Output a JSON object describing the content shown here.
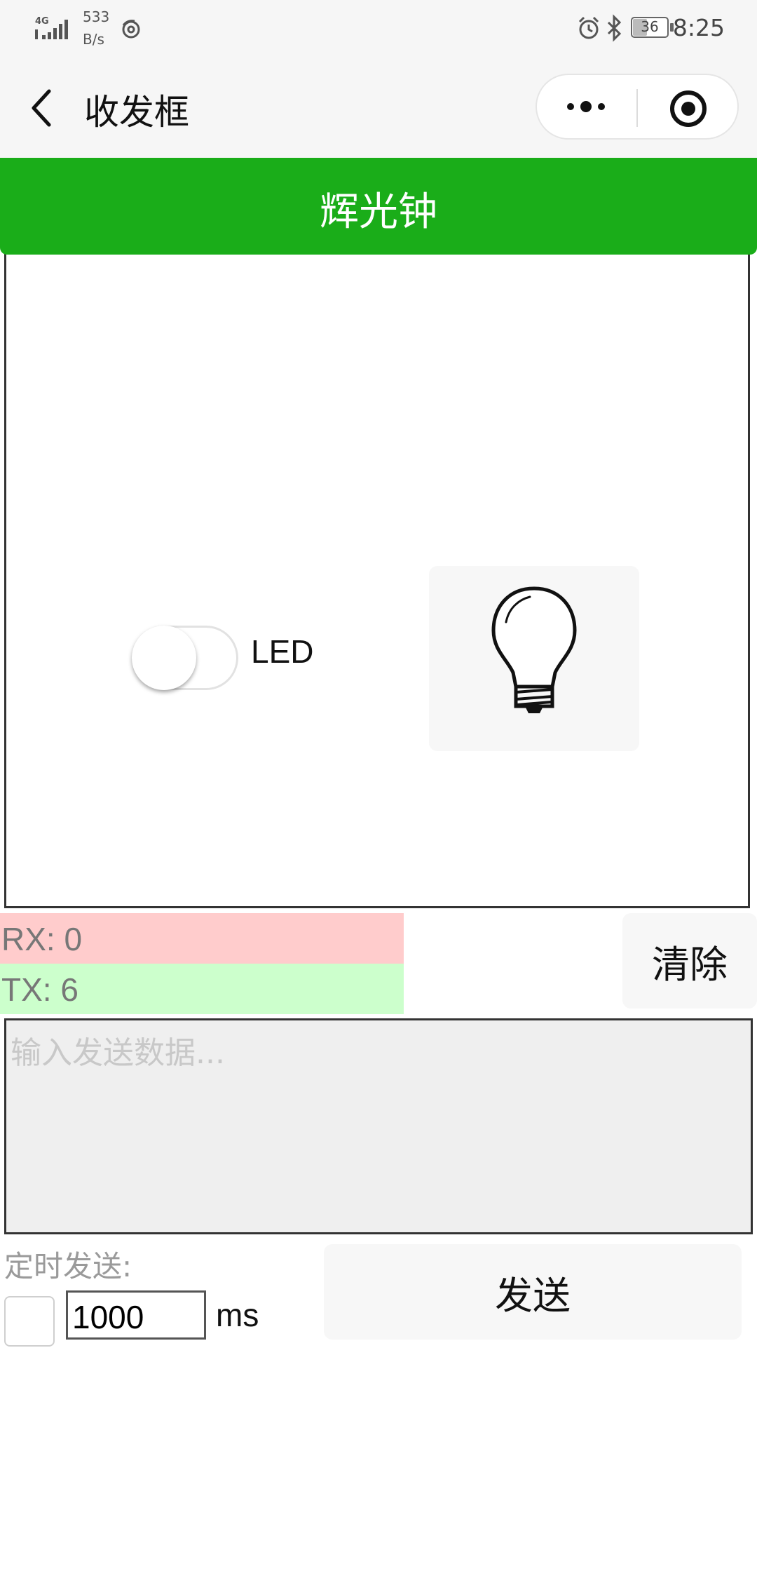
{
  "status_bar": {
    "network_type": "4G",
    "speed_value": "533",
    "speed_unit": "B/s",
    "battery_level": "36",
    "time": "8:25",
    "icons": [
      "signal-icon",
      "swirl-app-icon",
      "alarm-icon",
      "bluetooth-icon",
      "battery-icon"
    ]
  },
  "nav": {
    "title": "收发框",
    "back_icon": "chevron-left-icon",
    "more_icon": "more-dots-icon",
    "close_icon": "target-circle-icon"
  },
  "device": {
    "title": "辉光钟",
    "led_label": "LED",
    "led_on": false,
    "bulb_icon": "light-bulb-icon",
    "header_color": "#1aad19"
  },
  "counters": {
    "rx": "RX: 0",
    "tx": "TX: 6",
    "rx_color": "#ffcccc",
    "tx_color": "#ccffcc",
    "clear_label": "清除"
  },
  "send": {
    "placeholder": "输入发送数据...",
    "timer_label": "定时发送:",
    "timer_checked": false,
    "interval": "1000",
    "unit": "ms",
    "send_label": "发送"
  }
}
